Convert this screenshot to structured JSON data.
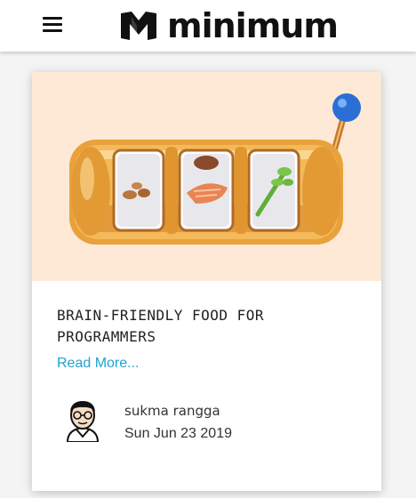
{
  "header": {
    "brand_name": "minimum",
    "menu_icon": "hamburger-menu-icon",
    "logo_icon": "brand-logo-icon"
  },
  "post": {
    "title": "BRAIN-FRIENDLY FOOD FOR PROGRAMMERS",
    "read_more": "Read More...",
    "author": "sukma rangga",
    "date": "Sun Jun 23 2019",
    "image_icon": "slot-machine-food-illustration",
    "avatar_icon": "author-avatar-icon"
  },
  "colors": {
    "link": "#1da1d4",
    "hero_background": "#fde9d5",
    "slot_gold": "#e9a23b",
    "lever_ball": "#2b6fd6"
  }
}
